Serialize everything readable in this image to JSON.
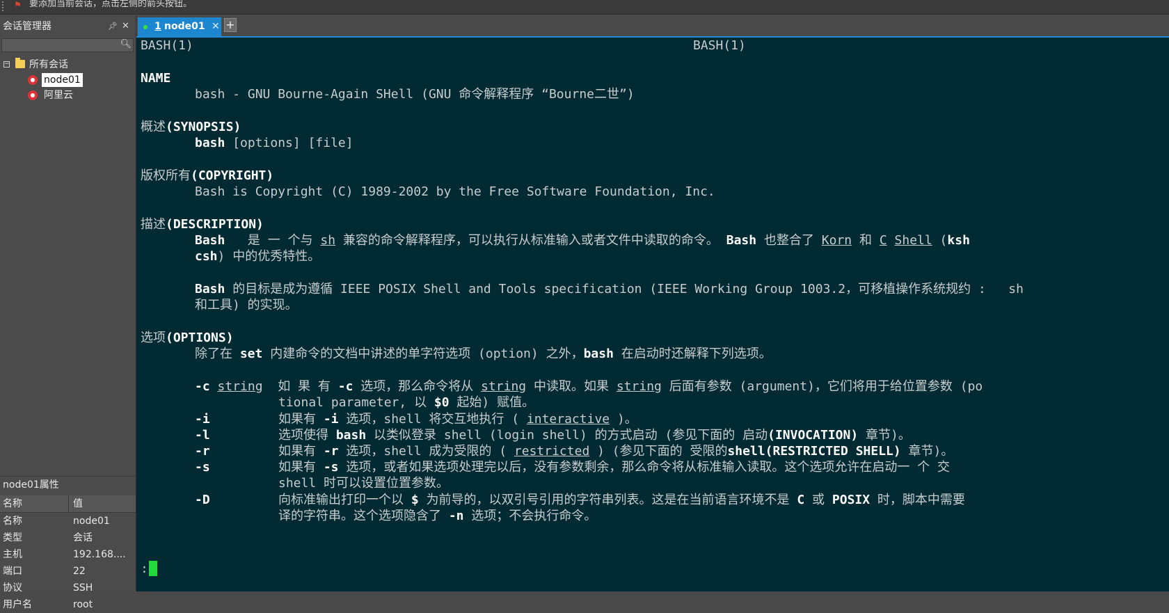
{
  "topbar": {
    "hint": "要添加当前会话，点击左侧的箭头按钮。"
  },
  "session_manager": {
    "title": "会话管理器",
    "pin_icon": "pin-icon",
    "close_icon": "close-icon",
    "search_placeholder": "",
    "tree": {
      "root_label": "所有会话",
      "sessions": [
        "node01",
        "阿里云"
      ],
      "selected": "node01"
    }
  },
  "properties": {
    "title": "node01属性",
    "col_name": "名称",
    "col_value": "值",
    "rows": [
      {
        "k": "名称",
        "v": "node01"
      },
      {
        "k": "类型",
        "v": "会话"
      },
      {
        "k": "主机",
        "v": "192.168...."
      },
      {
        "k": "端口",
        "v": "22"
      },
      {
        "k": "协议",
        "v": "SSH"
      },
      {
        "k": "用户名",
        "v": "root"
      }
    ]
  },
  "tabs": {
    "active": {
      "num": "1",
      "name": "node01"
    },
    "add_label": "+"
  },
  "terminal": {
    "header_left": "BASH(1)",
    "header_right": "BASH(1)",
    "name_heading": "NAME",
    "name_desc": "bash - GNU Bourne-Again SHell (GNU 命令解释程序 “Bourne二世”)",
    "synopsis_cn": "概述",
    "synopsis_en": "(SYNOPSIS)",
    "synopsis_cmd": "bash",
    "synopsis_args": " [options] [file]",
    "copyright_cn": "版权所有",
    "copyright_en": "(COPYRIGHT)",
    "copyright_text": "Bash is Copyright (C) 1989-2002 by the Free Software Foundation, Inc.",
    "desc_cn": "描述",
    "desc_en": "(DESCRIPTION)",
    "desc1_a": "Bash",
    "desc1_b": "   是 一 个与 ",
    "desc1_sh": "sh",
    "desc1_c": " 兼容的命令解释程序，可以执行从标准输入或者文件中读取的命令。 ",
    "desc1_d": "Bash",
    "desc1_e": " 也整合了 ",
    "desc1_korn": "Korn",
    "desc1_f": " 和 ",
    "desc1_c2": "C",
    "desc1_g": " ",
    "desc1_shell": "Shell",
    "desc1_h": " (",
    "desc1_ksh": "ksh",
    "desc2_csh": "csh",
    "desc2_rest": ") 中的优秀特性。",
    "desc3_bash": "Bash",
    "desc3_rest": " 的目标是成为遵循 IEEE POSIX Shell and Tools specification (IEEE Working Group 1003.2，可移植操作系统规约 :   sh",
    "desc4": "和工具) 的实现。",
    "options_cn": "选项",
    "options_en": "(OPTIONS)",
    "opt_intro_a": "除了在 ",
    "opt_intro_set": "set",
    "opt_intro_b": " 内建命令的文档中讲述的单字符选项 (option) 之外，",
    "opt_intro_bash": "bash",
    "opt_intro_c": " 在启动时还解释下列选项。",
    "opt_c_flag": "-c",
    "opt_c_arg": "string",
    "opt_c_a": "  如 果 有 ",
    "opt_c_flag2": "-c",
    "opt_c_b": " 选项，那么命令将从 ",
    "opt_c_str2": "string",
    "opt_c_c": " 中读取。如果 ",
    "opt_c_str3": "string",
    "opt_c_d": " 后面有参数 (argument)，它们将用于给位置参数 (po",
    "opt_c2_a": "tional parameter, 以 ",
    "opt_c2_0": "$0",
    "opt_c2_b": " 起始) 赋值。",
    "opt_i_flag": "-i",
    "opt_i_a": "如果有 ",
    "opt_i_flag2": "-i",
    "opt_i_b": " 选项，shell 将交互地执行 ( ",
    "opt_i_word": "interactive",
    "opt_i_c": " )。",
    "opt_l_flag": "-l",
    "opt_l_a": "选项使得 ",
    "opt_l_bash": "bash",
    "opt_l_b": " 以类似登录 shell (login shell) 的方式启动 (参见下面的 启动",
    "opt_l_inv": "(INVOCATION)",
    "opt_l_c": " 章节)。",
    "opt_r_flag": "-r",
    "opt_r_a": "如果有 ",
    "opt_r_flag2": "-r",
    "opt_r_b": " 选项，shell 成为受限的 ( ",
    "opt_r_word": "restricted",
    "opt_r_c": " ) (参见下面的 受限的",
    "opt_r_shell": "shell(RESTRICTED SHELL)",
    "opt_r_d": " 章节)。",
    "opt_s_flag": "-s",
    "opt_s_a": "如果有 ",
    "opt_s_flag2": "-s",
    "opt_s_b": " 选项，或者如果选项处理完以后，没有参数剩余，那么命令将从标准输入读取。这个选项允许在启动一 个 交",
    "opt_s2": "shell 时可以设置位置参数。",
    "opt_D_flag": "-D",
    "opt_D_a": "向标准输出打印一个以 ",
    "opt_D_dollar": "$",
    "opt_D_b": " 为前导的，以双引号引用的字符串列表。这是在当前语言环境不是 ",
    "opt_D_C": "C",
    "opt_D_c": " 或 ",
    "opt_D_posix": "POSIX",
    "opt_D_d": " 时，脚本中需要",
    "opt_D2_a": "译的字符串。这个选项隐含了 ",
    "opt_D2_n": "-n",
    "opt_D2_b": " 选项；不会执行命令。",
    "prompt": ":"
  },
  "colors": {
    "terminal_bg": "#012a33",
    "tab_active": "#1c86cf",
    "cursor": "#22d83a"
  }
}
